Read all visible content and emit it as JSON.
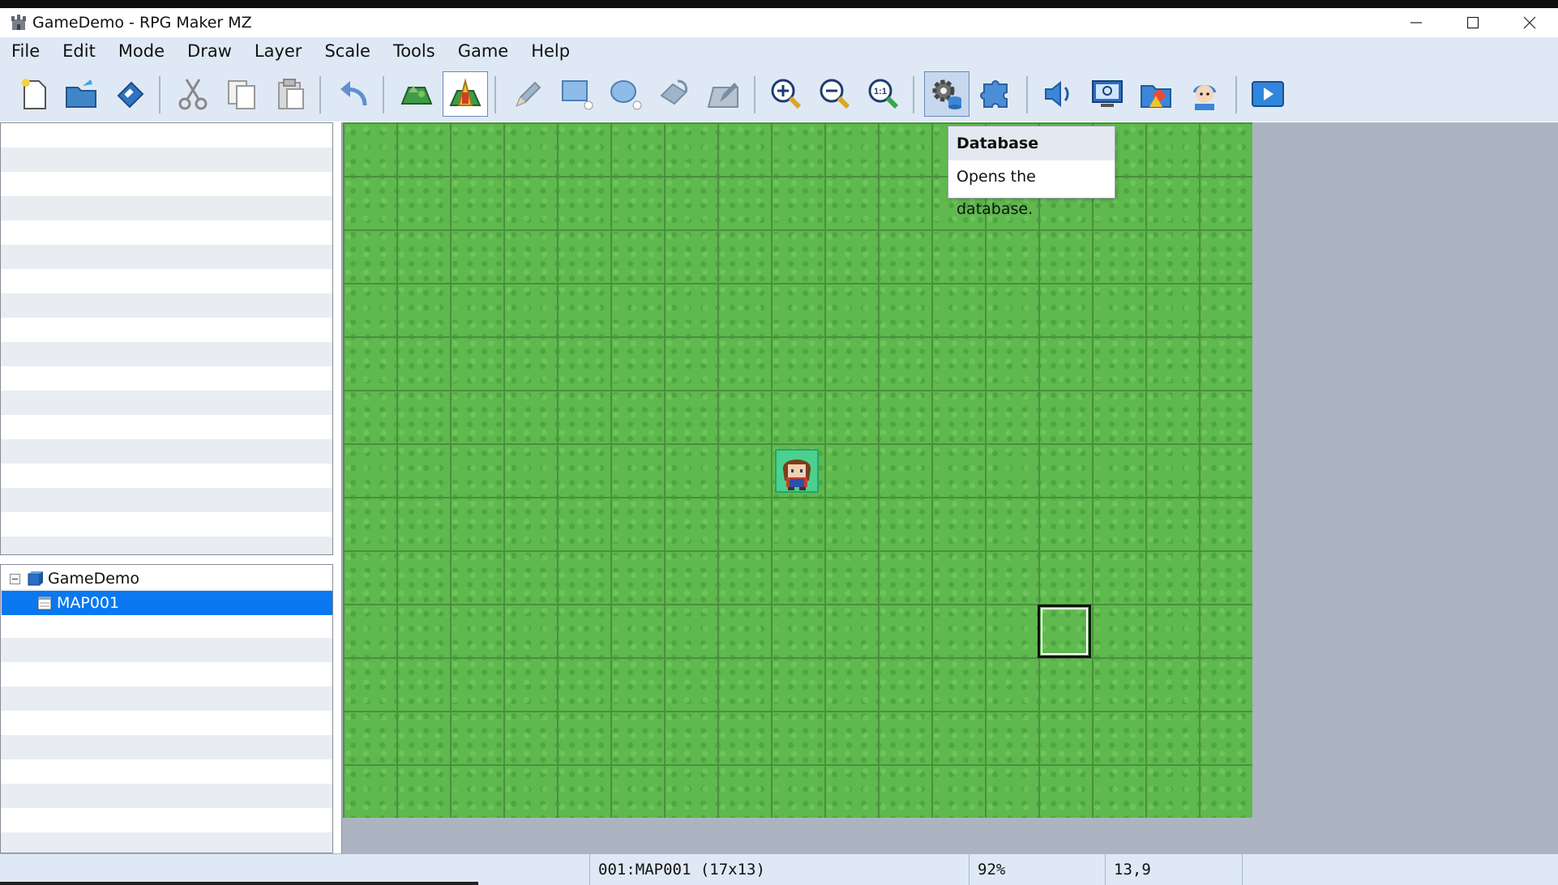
{
  "window": {
    "title": "GameDemo - RPG Maker MZ"
  },
  "menu": [
    "File",
    "Edit",
    "Mode",
    "Draw",
    "Layer",
    "Scale",
    "Tools",
    "Game",
    "Help"
  ],
  "toolbar": {
    "tools": [
      "new-project",
      "open-project",
      "save-project",
      "cut",
      "copy",
      "paste",
      "undo",
      "map-mode",
      "event-mode",
      "pencil",
      "rectangle",
      "ellipse",
      "flood-fill",
      "shadow-pen",
      "zoom-in",
      "zoom-out",
      "actual-size",
      "database",
      "plugin-manager",
      "sound-test",
      "event-searcher",
      "resource-manager",
      "character-generator",
      "playtest"
    ],
    "active": "event-mode",
    "hovered": "database",
    "actual_size_label": "1:1"
  },
  "tooltip": {
    "title": "Database",
    "description": "Opens the database."
  },
  "map_tree": {
    "items": [
      {
        "label": "GameDemo",
        "level": 0,
        "expanded": true
      },
      {
        "label": "MAP001",
        "level": 1,
        "selected": true
      }
    ]
  },
  "status": {
    "map": "001:MAP001 (17x13)",
    "zoom": "92%",
    "coords": "13,9"
  },
  "colors": {
    "accent": "#0a78f1",
    "grass": "#5fb94e",
    "chrome": "#dfe9f5",
    "workspace": "#adb4c1"
  }
}
